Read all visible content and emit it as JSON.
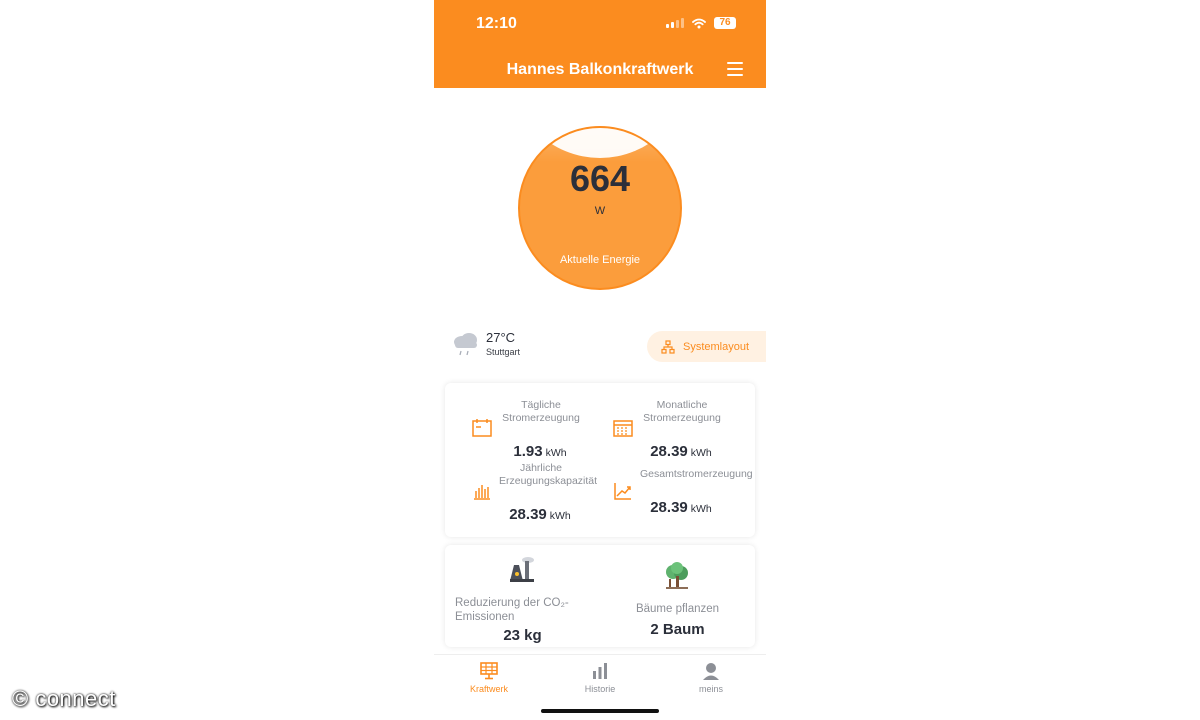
{
  "status_bar": {
    "time": "12:10",
    "battery": "76"
  },
  "header": {
    "title": "Hannes Balkonkraftwerk",
    "menu_icon": "hamburger-menu-icon"
  },
  "gauge": {
    "value": "664",
    "unit": "W",
    "label": "Aktuelle Energie"
  },
  "weather": {
    "temperature": "27°C",
    "city": "Stuttgart",
    "icon": "rain-cloud-icon"
  },
  "system_layout": {
    "label": "Systemlayout",
    "icon": "network-layout-icon"
  },
  "stats": [
    {
      "label": "Tägliche Stromerzeugung",
      "value": "1.93",
      "unit": "kWh",
      "icon": "battery-calendar-icon"
    },
    {
      "label": "Monatliche Stromerzeugung",
      "value": "28.39",
      "unit": "kWh",
      "icon": "calendar-grid-icon"
    },
    {
      "label": "Jährliche Erzeugungskapazität",
      "value": "28.39",
      "unit": "kWh",
      "icon": "bar-chart-icon"
    },
    {
      "label": "Gesamtstromerzeugung",
      "value": "28.39",
      "unit": "kWh",
      "icon": "trend-line-icon"
    }
  ],
  "eco": [
    {
      "label": "Reduzierung der CO₂-Emissionen",
      "value": "23 kg",
      "icon": "factory-icon"
    },
    {
      "label": "Bäume pflanzen",
      "value": "2 Baum",
      "icon": "tree-icon"
    }
  ],
  "tabs": [
    {
      "label": "Kraftwerk",
      "icon": "solar-panel-icon",
      "active": true
    },
    {
      "label": "Historie",
      "icon": "bar-chart-icon",
      "active": false
    },
    {
      "label": "meins",
      "icon": "person-icon",
      "active": false
    }
  ],
  "watermark": "© connect",
  "colors": {
    "accent": "#fb8c1f",
    "gauge_fill": "#fb9d3c",
    "text_dark": "#2b2f3a",
    "text_muted": "#8c8f96"
  }
}
